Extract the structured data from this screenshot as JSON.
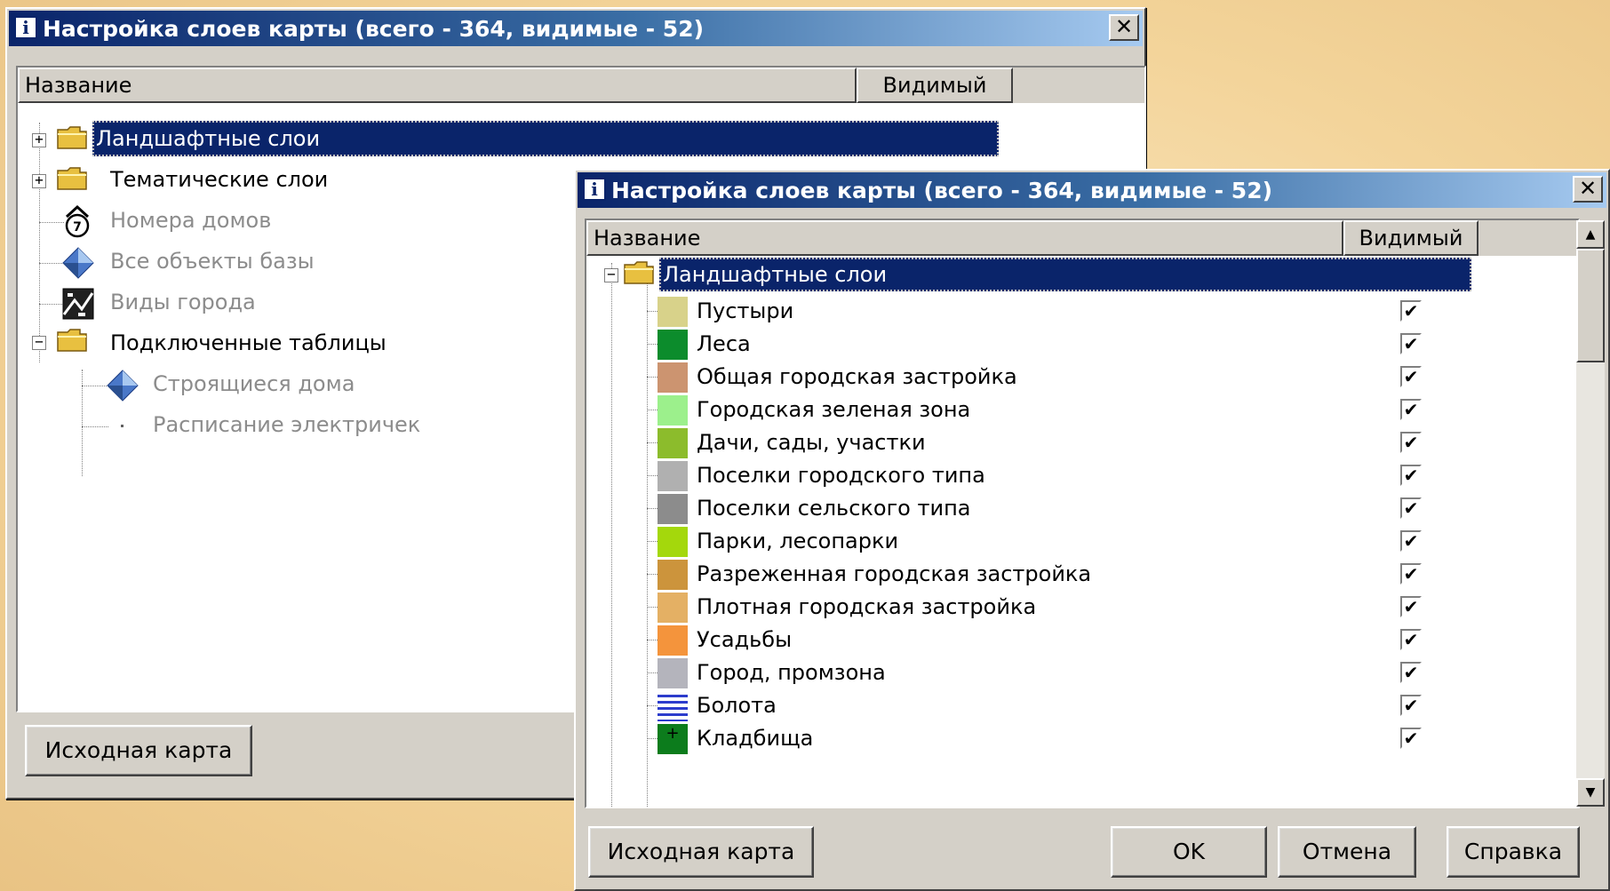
{
  "back_window": {
    "title": "Настройка слоев карты (всего - 364, видимые - 52)",
    "columns": {
      "name": "Название",
      "visible": "Видимый"
    },
    "tree": [
      {
        "label": "Ландшафтные слои",
        "icon": "folder-icon",
        "expander": "+",
        "selected": true,
        "dim": false
      },
      {
        "label": "Тематические слои",
        "icon": "folder-icon",
        "expander": "+",
        "selected": false,
        "dim": false
      },
      {
        "label": "Номера домов",
        "icon": "house-number-icon",
        "selected": false,
        "dim": true
      },
      {
        "label": "Все объекты базы",
        "icon": "diamond-icon",
        "selected": false,
        "dim": true
      },
      {
        "label": "Виды города",
        "icon": "photo-icon",
        "selected": false,
        "dim": true
      },
      {
        "label": "Подключенные таблицы",
        "icon": "folder-icon",
        "expander": "−",
        "selected": false,
        "dim": false
      },
      {
        "label": "Строящиеся дома",
        "icon": "diamond-icon",
        "selected": false,
        "dim": true
      },
      {
        "label": "Расписание электричек",
        "icon": "dot-icon",
        "selected": false,
        "dim": true
      }
    ],
    "buttons": {
      "original_map": "Исходная карта"
    }
  },
  "front_window": {
    "title": "Настройка слоев карты (всего - 364, видимые - 52)",
    "columns": {
      "name": "Название",
      "visible": "Видимый"
    },
    "root": {
      "label": "Ландшафтные слои",
      "expander": "−"
    },
    "layers": [
      {
        "label": "Пустыри",
        "color": "#d8d28a",
        "visible": true
      },
      {
        "label": "Леса",
        "color": "#0c8c2c",
        "visible": true
      },
      {
        "label": "Общая городская застройка",
        "color": "#cc9470",
        "visible": true
      },
      {
        "label": "Городская зеленая зона",
        "color": "#9cf08c",
        "visible": true
      },
      {
        "label": "Дачи, сады, участки",
        "color": "#8cbc2c",
        "visible": true
      },
      {
        "label": "Поселки городского типа",
        "color": "#b0b0b0",
        "visible": true
      },
      {
        "label": "Поселки сельского типа",
        "color": "#8c8c8c",
        "visible": true
      },
      {
        "label": "Парки, лесопарки",
        "color": "#a4d80c",
        "visible": true
      },
      {
        "label": "Разреженная городская застройка",
        "color": "#cc943c",
        "visible": true
      },
      {
        "label": "Плотная городская застройка",
        "color": "#e4b064",
        "visible": true
      },
      {
        "label": "Усадьбы",
        "color": "#f4943c",
        "visible": true
      },
      {
        "label": "Город, промзона",
        "color": "#b4b4bc",
        "visible": true
      },
      {
        "label": "Болота",
        "color": "#2c3ccc",
        "icon": "swamp-icon",
        "visible": true
      },
      {
        "label": "Кладбища",
        "color": "#0c7c1c",
        "icon": "cemetery-icon",
        "visible": true
      }
    ],
    "buttons": {
      "original_map": "Исходная карта",
      "ok": "OK",
      "cancel": "Отмена",
      "help": "Справка"
    }
  }
}
